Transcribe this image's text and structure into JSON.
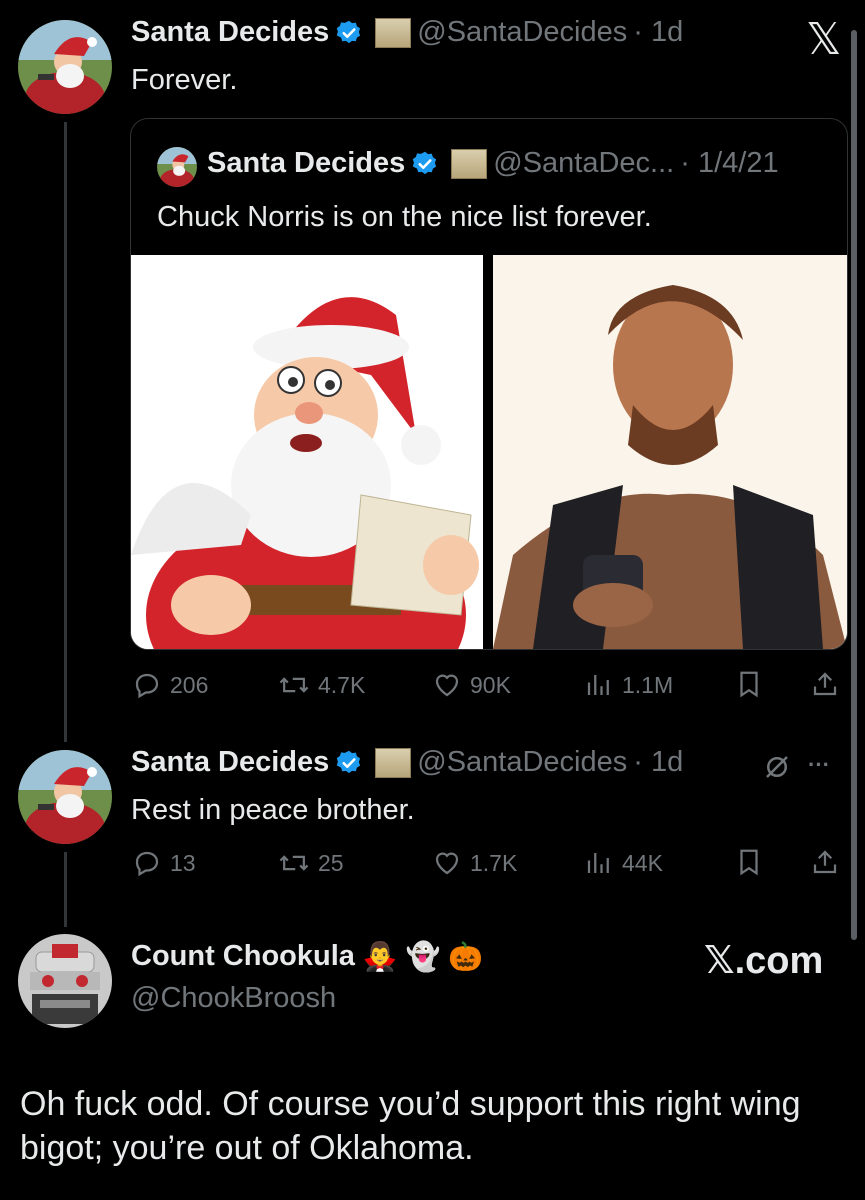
{
  "tweet1": {
    "name": "Santa Decides",
    "handle": "@SantaDecides",
    "time": "· 1d",
    "text": "Forever."
  },
  "quote": {
    "name": "Santa Decides",
    "handle": "@SantaDec...",
    "time": "· 1/4/21",
    "text": "Chuck Norris is on the nice list forever.",
    "replies": "206",
    "reposts": "4.7K",
    "likes": "90K",
    "views": "1.1M"
  },
  "tweet2": {
    "name": "Santa Decides",
    "handle": "@SantaDecides",
    "time": "· 1d",
    "text": "Rest in peace brother.",
    "replies": "13",
    "reposts": "25",
    "likes": "1.7K",
    "views": "44K"
  },
  "reply": {
    "name": "Count Chookula",
    "emojis": "🧛‍♂️ 👻 🎃",
    "handle": "@ChookBroosh",
    "text": "Oh fuck odd. Of course you’d support this right wing bigot; you’re out of Oklahoma.",
    "watermark": "𝕏.com"
  },
  "icons": {
    "x_logo": "𝕏",
    "more": "···"
  },
  "colors": {
    "verified": "#1d9bf0",
    "muted": "#71767b",
    "text": "#e7e9ea"
  }
}
